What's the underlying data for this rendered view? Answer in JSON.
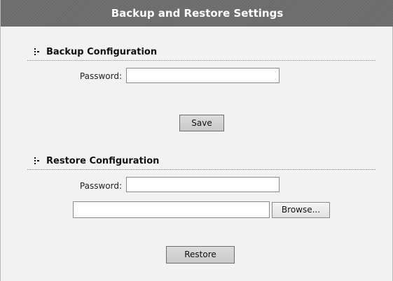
{
  "title": "Backup and Restore Settings",
  "backup": {
    "heading": "Backup Configuration",
    "password_label": "Password:",
    "password_value": "",
    "save_label": "Save"
  },
  "restore": {
    "heading": "Restore Configuration",
    "password_label": "Password:",
    "password_value": "",
    "file_value": "",
    "browse_label": "Browse...",
    "restore_label": "Restore"
  },
  "colors": {
    "title_bar": "#6b6b6b",
    "panel_background": "#f2f2f2",
    "button_background": "#cfcfcf"
  },
  "icons": {
    "section_bullet": "dotted-bullet-icon"
  }
}
